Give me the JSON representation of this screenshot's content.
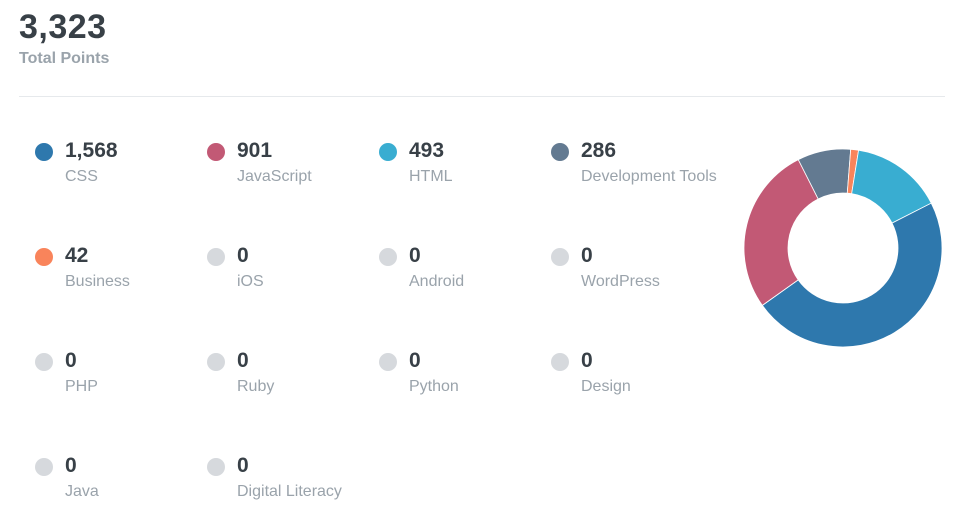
{
  "summary": {
    "total_value": "3,323",
    "total_label": "Total Points"
  },
  "stats": [
    {
      "value": "1,568",
      "label": "CSS",
      "color": "#2e78ad"
    },
    {
      "value": "901",
      "label": "JavaScript",
      "color": "#c25975"
    },
    {
      "value": "493",
      "label": "HTML",
      "color": "#39add1"
    },
    {
      "value": "286",
      "label": "Development Tools",
      "color": "#637a91"
    },
    {
      "value": "42",
      "label": "Business",
      "color": "#f9845b"
    },
    {
      "value": "0",
      "label": "iOS",
      "color": "#d6d9dd"
    },
    {
      "value": "0",
      "label": "Android",
      "color": "#d6d9dd"
    },
    {
      "value": "0",
      "label": "WordPress",
      "color": "#d6d9dd"
    },
    {
      "value": "0",
      "label": "PHP",
      "color": "#d6d9dd"
    },
    {
      "value": "0",
      "label": "Ruby",
      "color": "#d6d9dd"
    },
    {
      "value": "0",
      "label": "Python",
      "color": "#d6d9dd"
    },
    {
      "value": "0",
      "label": "Design",
      "color": "#d6d9dd"
    },
    {
      "value": "0",
      "label": "Java",
      "color": "#d6d9dd"
    },
    {
      "value": "0",
      "label": "Digital Literacy",
      "color": "#d6d9dd"
    }
  ],
  "chart_data": {
    "type": "pie",
    "title": "",
    "categories": [
      "CSS",
      "JavaScript",
      "HTML",
      "Development Tools",
      "Business"
    ],
    "values": [
      1568,
      901,
      493,
      286,
      42
    ],
    "colors": [
      "#2e78ad",
      "#c25975",
      "#39add1",
      "#637a91",
      "#f9845b"
    ],
    "donut": true
  }
}
